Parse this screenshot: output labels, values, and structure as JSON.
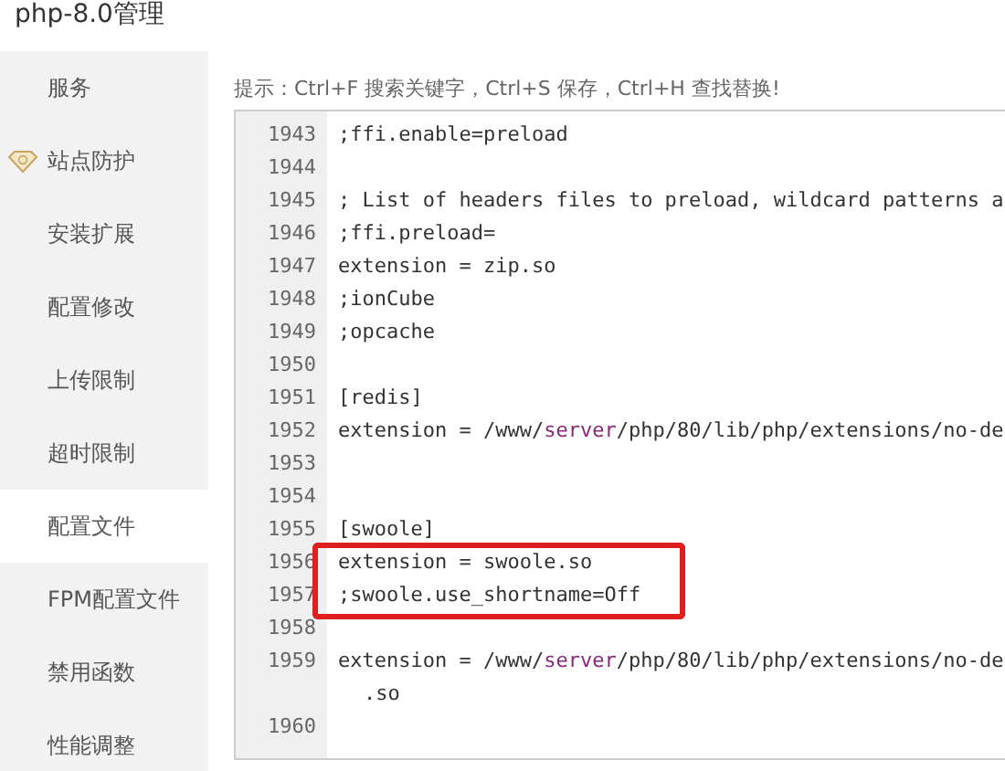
{
  "window": {
    "title": "php-8.0管理"
  },
  "sidebar": {
    "items": [
      {
        "label": "服务",
        "selected": false,
        "kind": "plain"
      },
      {
        "label": "站点防护",
        "selected": false,
        "kind": "icon"
      },
      {
        "label": "安装扩展",
        "selected": false,
        "kind": "plain"
      },
      {
        "label": "配置修改",
        "selected": false,
        "kind": "plain"
      },
      {
        "label": "上传限制",
        "selected": false,
        "kind": "plain"
      },
      {
        "label": "超时限制",
        "selected": false,
        "kind": "plain"
      },
      {
        "label": "配置文件",
        "selected": true,
        "kind": "plain"
      },
      {
        "label": "FPM配置文件",
        "selected": false,
        "kind": "plain"
      },
      {
        "label": "禁用函数",
        "selected": false,
        "kind": "plain"
      },
      {
        "label": "性能调整",
        "selected": false,
        "kind": "plain"
      }
    ]
  },
  "hint": "提示：Ctrl+F 搜索关键字，Ctrl+S 保存，Ctrl+H 查找替换!",
  "editor": {
    "lines": [
      {
        "number": "1943",
        "highlighted": false,
        "segments": [
          {
            "text": ";ffi.enable=preload",
            "kind": "plain"
          }
        ]
      },
      {
        "number": "1944",
        "highlighted": false
      },
      {
        "number": "1945",
        "highlighted": false,
        "segments": [
          {
            "text": "; List of headers files to preload, wildcard patterns a",
            "kind": "plain"
          }
        ]
      },
      {
        "number": "1946",
        "highlighted": false,
        "segments": [
          {
            "text": ";ffi.preload=",
            "kind": "plain"
          }
        ]
      },
      {
        "number": "1947",
        "highlighted": false,
        "segments": [
          {
            "text": "extension = zip.so",
            "kind": "plain"
          }
        ]
      },
      {
        "number": "1948",
        "highlighted": false,
        "segments": [
          {
            "text": ";ionCube",
            "kind": "plain"
          }
        ]
      },
      {
        "number": "1949",
        "highlighted": false,
        "segments": [
          {
            "text": ";opcache",
            "kind": "plain"
          }
        ]
      },
      {
        "number": "1950",
        "highlighted": false
      },
      {
        "number": "1951",
        "highlighted": false,
        "segments": [
          {
            "text": "[redis]",
            "kind": "plain"
          }
        ]
      },
      {
        "number": "1952",
        "highlighted": false,
        "segments": [
          {
            "text": "extension = /www/",
            "kind": "plain"
          },
          {
            "text": "server",
            "kind": "keyword"
          },
          {
            "text": "/php/80/lib/php/extensions/no-de",
            "kind": "plain"
          }
        ]
      },
      {
        "number": "1953",
        "highlighted": false
      },
      {
        "number": "1954",
        "highlighted": false
      },
      {
        "number": "1955",
        "highlighted": false,
        "segments": [
          {
            "text": "[swoole]",
            "kind": "plain"
          }
        ]
      },
      {
        "number": "1956",
        "highlighted": true,
        "segments": [
          {
            "text": "extension = swoole.so",
            "kind": "plain"
          }
        ]
      },
      {
        "number": "1957",
        "highlighted": true,
        "segments": [
          {
            "text": ";swoole.use_shortname=Off",
            "kind": "plain"
          }
        ]
      },
      {
        "number": "1958",
        "highlighted": false
      },
      {
        "number": "1959",
        "highlighted": false,
        "segments": [
          {
            "text": "extension = /www/",
            "kind": "plain"
          },
          {
            "text": "server",
            "kind": "keyword"
          },
          {
            "text": "/php/80/lib/php/extensions/no-de",
            "kind": "plain"
          }
        ],
        "wrapped": ".so"
      },
      {
        "number": "1960",
        "highlighted": false
      }
    ]
  }
}
